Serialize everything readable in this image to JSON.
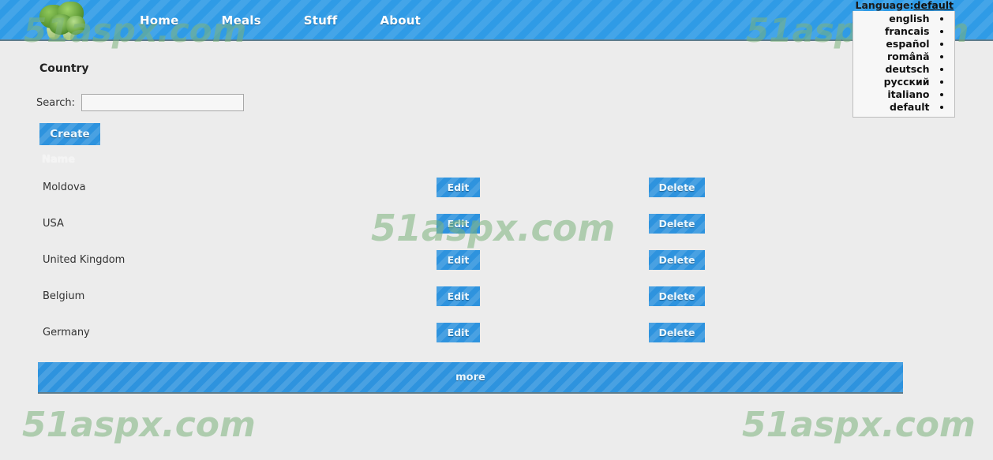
{
  "header": {
    "logo_alt": "broccoli-logo",
    "nav": [
      {
        "label": "Home"
      },
      {
        "label": "Meals"
      },
      {
        "label": "Stuff"
      },
      {
        "label": "About"
      }
    ]
  },
  "language": {
    "label_prefix": "Language:",
    "current": "default",
    "options": [
      {
        "label": "english"
      },
      {
        "label": "francais"
      },
      {
        "label": "español"
      },
      {
        "label": "română"
      },
      {
        "label": "deutsch"
      },
      {
        "label": "русский"
      },
      {
        "label": "italiano"
      },
      {
        "label": "default"
      }
    ]
  },
  "main": {
    "title": "Country",
    "search_label": "Search:",
    "search_value": "",
    "search_placeholder": "",
    "create_label": "Create",
    "column_header_name": "Name",
    "edit_label": "Edit",
    "delete_label": "Delete",
    "more_label": "more",
    "rows": [
      {
        "name": "Moldova"
      },
      {
        "name": "USA"
      },
      {
        "name": "United Kingdom"
      },
      {
        "name": "Belgium"
      },
      {
        "name": "Germany"
      }
    ]
  },
  "watermark": {
    "text": "51aspx.com"
  },
  "colors": {
    "header_blue": "#2f9be6",
    "button_blue": "#2e93de",
    "page_background": "#ececec",
    "watermark_green": "#7cb37c"
  }
}
